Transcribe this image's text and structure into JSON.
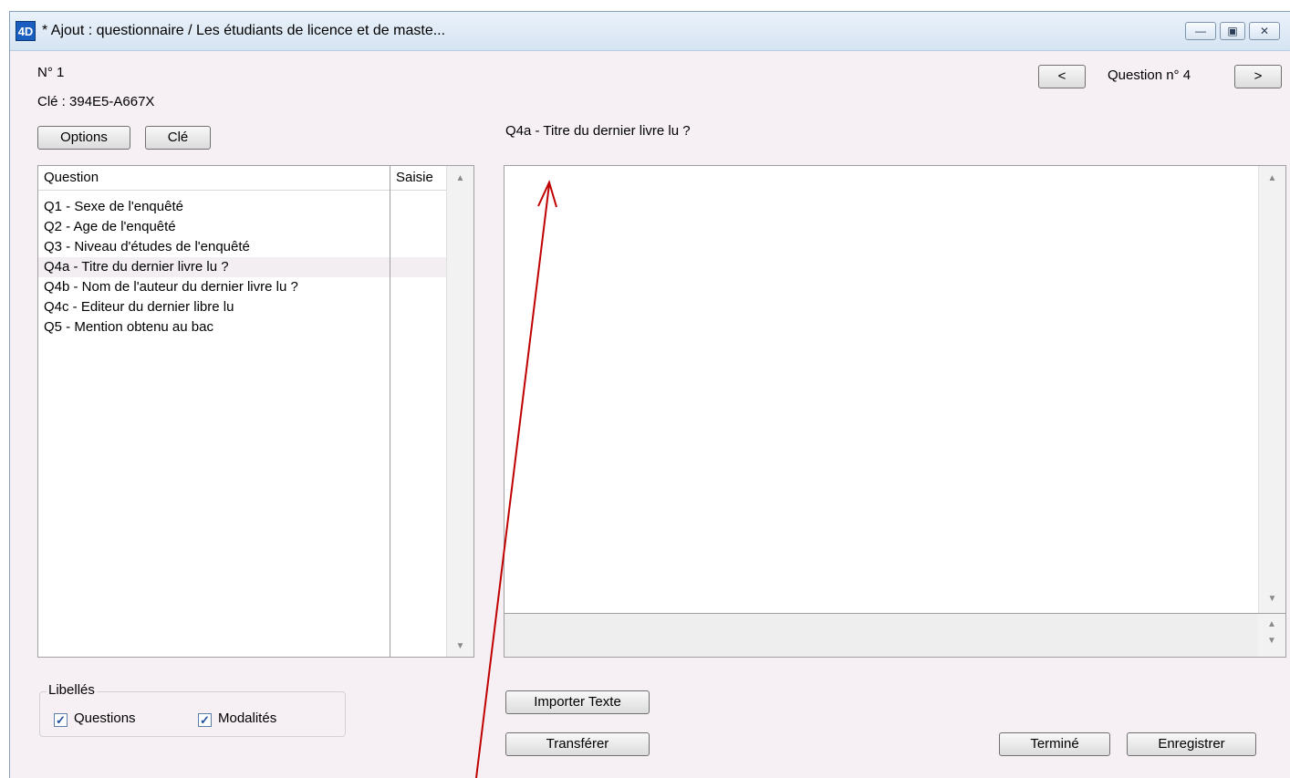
{
  "window": {
    "title": "* Ajout : questionnaire / Les étudiants de licence et de maste...",
    "app_icon_text": "4D",
    "controls": [
      "minimize-icon",
      "maximize-icon",
      "close-icon"
    ]
  },
  "header": {
    "record_number": "N° 1",
    "key": "Clé : 394E5-A667X",
    "options_label": "Options",
    "key_button_label": "Clé",
    "question_counter": "Question n° 4",
    "prev_label": "<",
    "next_label": ">",
    "current_question": "Q4a - Titre du dernier livre lu ?"
  },
  "question_list": {
    "columns": [
      "Question",
      "Saisie"
    ],
    "rows": [
      {
        "question": "Q1 - Sexe de l'enquêté",
        "saisie": ""
      },
      {
        "question": "Q2 - Age de l'enquêté",
        "saisie": ""
      },
      {
        "question": "Q3 - Niveau d'études de l'enquêté",
        "saisie": ""
      },
      {
        "question": "Q4a - Titre du dernier livre lu ?",
        "saisie": "",
        "selected": true
      },
      {
        "question": "Q4b - Nom de l'auteur du dernier livre lu ?",
        "saisie": ""
      },
      {
        "question": "Q4c - Editeur du dernier libre lu",
        "saisie": ""
      },
      {
        "question": "Q5 - Mention obtenu au bac",
        "saisie": ""
      }
    ]
  },
  "answer": {
    "value": ""
  },
  "labels_group": {
    "title": "Libellés",
    "questions_label": "Questions",
    "questions_checked": true,
    "modalites_label": "Modalités",
    "modalites_checked": true
  },
  "buttons": {
    "import_text": "Importer Texte",
    "transfer": "Transférer",
    "done": "Terminé",
    "save": "Enregistrer"
  },
  "annotation": {
    "color": "#c00000"
  }
}
